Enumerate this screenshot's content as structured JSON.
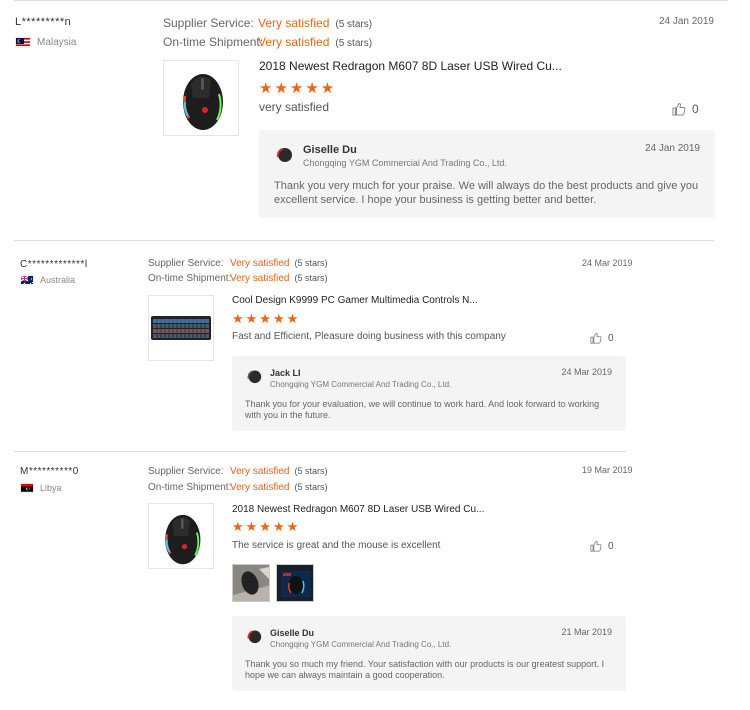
{
  "labels": {
    "supplier_service": "Supplier Service:",
    "ontime_shipment": "On-time Shipment:"
  },
  "reviews": [
    {
      "buyer": "L*********n",
      "country": "Malaysia",
      "supplier_service": "Very satisfied",
      "supplier_stars": "(5 stars)",
      "shipment": "Very satisfied",
      "shipment_stars": "(5 stars)",
      "date": "24 Jan 2019",
      "product_title": "2018 Newest Redragon M607 8D Laser USB Wired Cu...",
      "stars": "★★★★★",
      "rating": 5,
      "comment": "very satisfied",
      "likes": "0",
      "reply": {
        "seller": "Giselle Du",
        "company": "Chongqing YGM Commercial And Trading Co., Ltd.",
        "date": "24 Jan 2019",
        "text": "Thank you very much for your praise. We will always do the best products and give you excellent service. I hope your business is getting better and better."
      }
    },
    {
      "buyer": "C*************l",
      "country": "Australia",
      "supplier_service": "Very satisfied",
      "supplier_stars": "(5 stars)",
      "shipment": "Very satisfied",
      "shipment_stars": "(5 stars)",
      "date": "24 Mar 2019",
      "product_title": "Cool Design K9999 PC Gamer Multimedia Controls N...",
      "stars": "★★★★★",
      "rating": 5,
      "comment": "Fast and Efficient, Pleasure doing business with this company",
      "likes": "0",
      "reply": {
        "seller": "Jack LI",
        "company": "Chongqing YGM Commercial And Trading Co., Ltd.",
        "date": "24 Mar 2019",
        "text": "Thank you for your evaluation, we will continue to work hard. And look forward to working with you in the future."
      }
    },
    {
      "buyer": "M**********0",
      "country": "Libya",
      "supplier_service": "Very satisfied",
      "supplier_stars": "(5 stars)",
      "shipment": "Very satisfied",
      "shipment_stars": "(5 stars)",
      "date": "19 Mar 2019",
      "product_title": "2018 Newest Redragon M607 8D Laser USB Wired Cu...",
      "stars": "★★★★★",
      "rating": 5,
      "comment": "The service is great and the mouse is excellent",
      "likes": "0",
      "reply": {
        "seller": "Giselle Du",
        "company": "Chongqing YGM Commercial And Trading Co., Ltd.",
        "date": "21 Mar 2019",
        "text": "Thank you so much my friend. Your satisfaction with our products is our greatest support. I hope we can always maintain a good cooperation."
      }
    }
  ],
  "colors": {
    "accent": "#f06414",
    "reply_bg": "#f4f4f4",
    "divider": "#dddddd"
  }
}
